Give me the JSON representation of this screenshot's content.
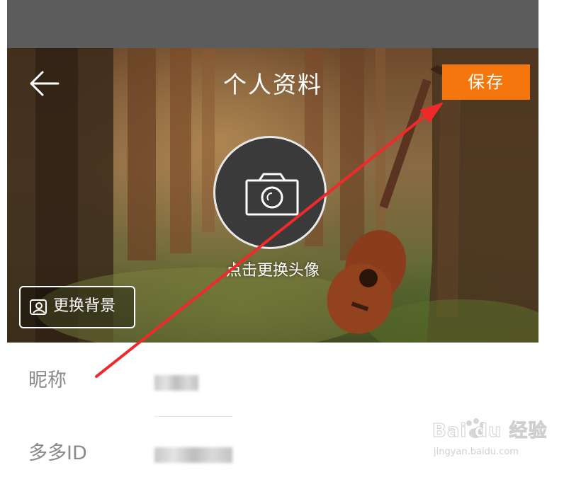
{
  "header": {
    "title": "个人资料",
    "back_icon": "arrow-left-icon",
    "save_label": "保存",
    "save_color": "#f5760c"
  },
  "avatar": {
    "icon": "camera-icon",
    "hint": "点击更换头像"
  },
  "change_background": {
    "icon": "portrait-frame-icon",
    "label": "更换背景"
  },
  "form": {
    "nickname_label": "昵称",
    "id_label": "多多ID"
  },
  "watermark": {
    "main": "Bai du 经验",
    "sub": "jingyan.baidu.com"
  },
  "annotation_color": "#f02a2a"
}
